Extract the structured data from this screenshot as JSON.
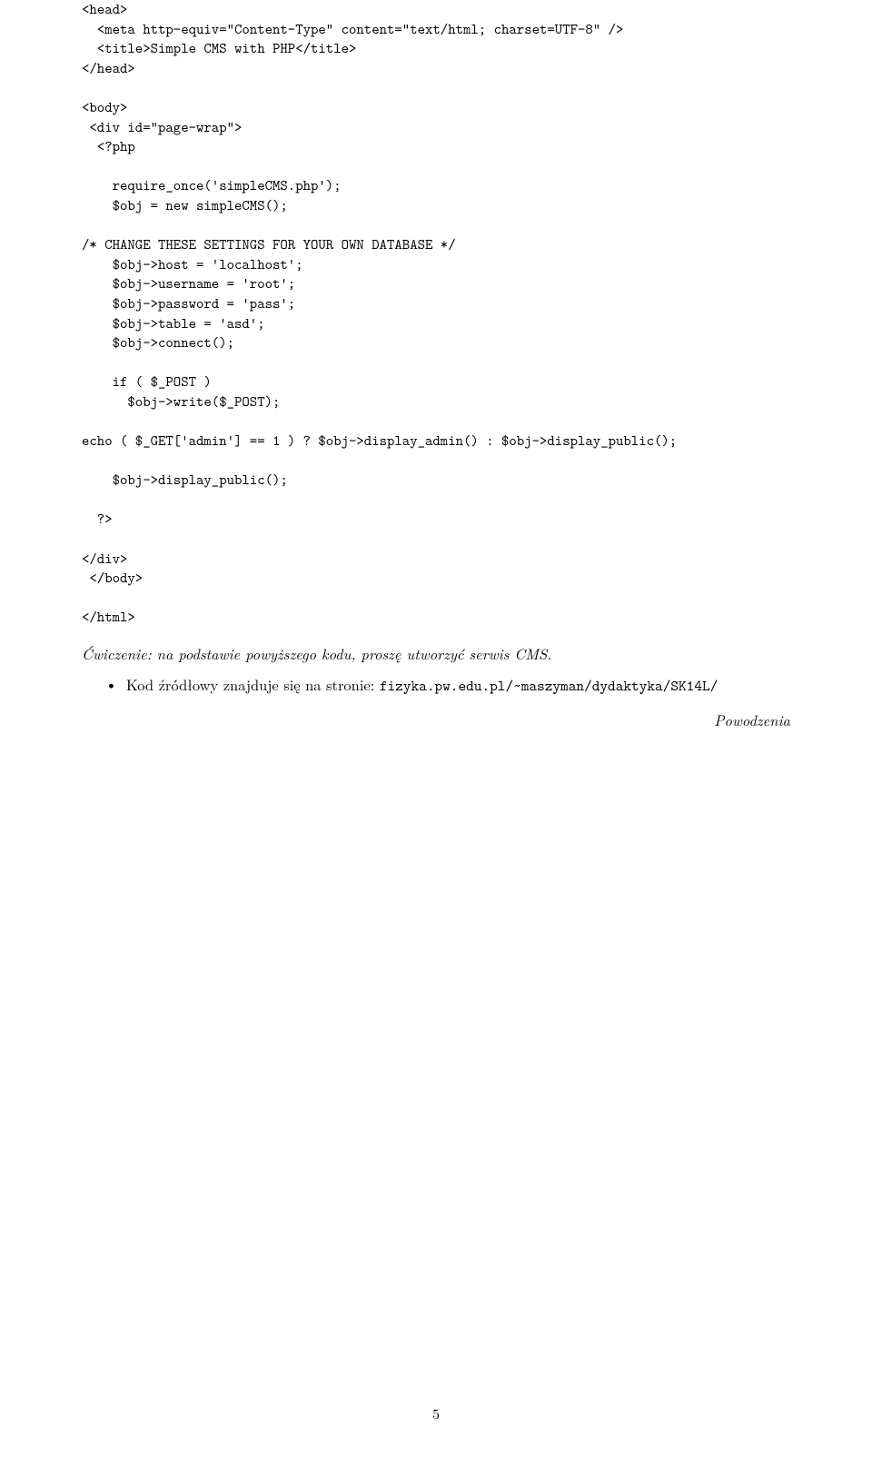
{
  "code": "<head>\n  <meta http-equiv=\"Content-Type\" content=\"text/html; charset=UTF-8\" />\n  <title>Simple CMS with PHP</title>\n</head>\n\n<body>\n <div id=\"page-wrap\">\n  <?php\n\n    require_once('simpleCMS.php');\n    $obj = new simpleCMS();\n\n/* CHANGE THESE SETTINGS FOR YOUR OWN DATABASE */\n    $obj->host = 'localhost';\n    $obj->username = 'root';\n    $obj->password = 'pass';\n    $obj->table = 'asd';\n    $obj->connect();\n\n    if ( $_POST )\n      $obj->write($_POST);\n\necho ( $_GET['admin'] == 1 ) ? $obj->display_admin() : $obj->display_public();\n\n    $obj->display_public();\n\n  ?>\n\n</div>\n </body>\n\n</html>",
  "exercise": "Ćwiczenie: na podstawie powyższego kodu, proszę utworzyć serwis CMS.",
  "bullet": {
    "text_before": "Kod źródłowy znajduje się na stronie: ",
    "url": "fizyka.pw.edu.pl/~maszyman/dydaktyka/SK14L/"
  },
  "success": "Powodzenia",
  "page_number": "5"
}
